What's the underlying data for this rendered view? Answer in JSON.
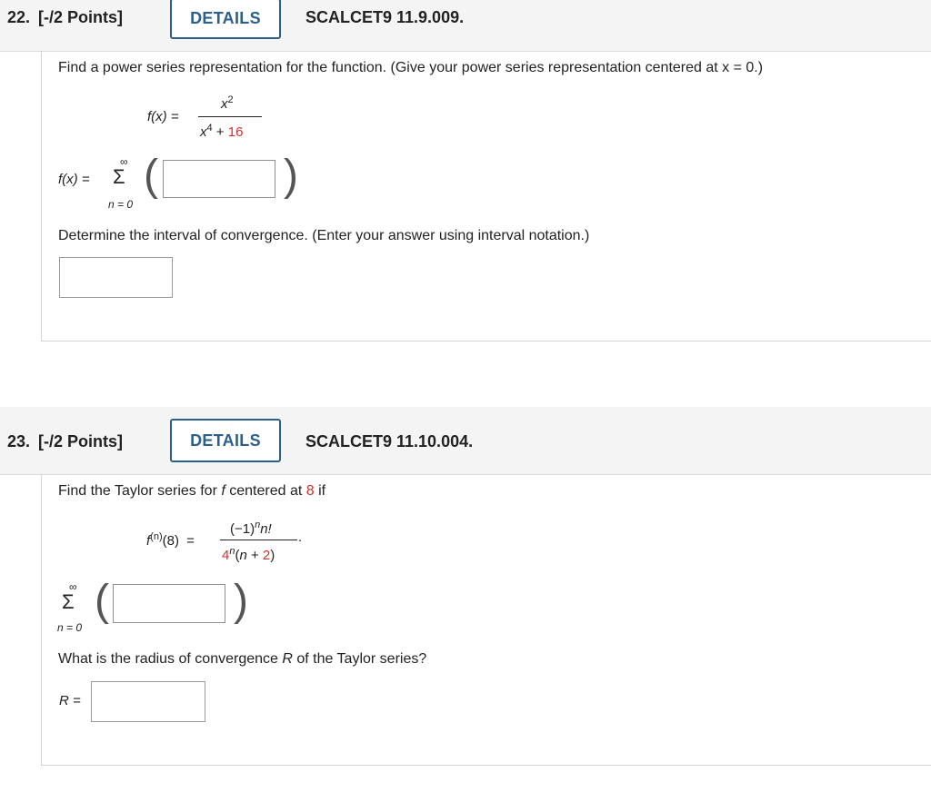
{
  "q22": {
    "number": "22.",
    "points": "[-/2 Points]",
    "details_label": "DETAILS",
    "code": "SCALCET9 11.9.009.",
    "prompt": "Find a power series representation for the function. (Give your power series representation centered at x = 0.)",
    "fx_label": "f(x) =",
    "numerator": "x",
    "numerator_exp": "2",
    "denominator": "x",
    "denominator_exp": "4",
    "denominator_plus": "+",
    "denominator_const": "16",
    "sum_fx_label": "f(x) =",
    "sum_top": "∞",
    "sum_symbol": "Σ",
    "sum_bottom": "n = 0",
    "interval_prompt": "Determine the interval of convergence. (Enter your answer using interval notation.)"
  },
  "q23": {
    "number": "23.",
    "points": "[-/2 Points]",
    "details_label": "DETAILS",
    "code": "SCALCET9 11.10.004.",
    "prompt_pre": "Find the Taylor series for ",
    "prompt_f": "f",
    "prompt_mid": " centered at ",
    "prompt_center": "8",
    "prompt_post": " if",
    "lhs_f": "f",
    "lhs_exp": "(n)",
    "lhs_arg": "(8)",
    "lhs_eq": "=",
    "num_text": "(−1)",
    "num_exp": "n",
    "num_rest": "n!",
    "den_base": "4",
    "den_exp": "n",
    "den_open": "(",
    "den_n": "n",
    "den_plus": " + ",
    "den_two": "2",
    "den_close": ")",
    "period": ".",
    "sum_top": "∞",
    "sum_symbol": "Σ",
    "sum_bottom": "n = 0",
    "radius_prompt_pre": "What is the radius of convergence ",
    "radius_R": "R",
    "radius_prompt_post": " of the Taylor series?",
    "radius_label": "R =",
    "radius_answer": ""
  }
}
